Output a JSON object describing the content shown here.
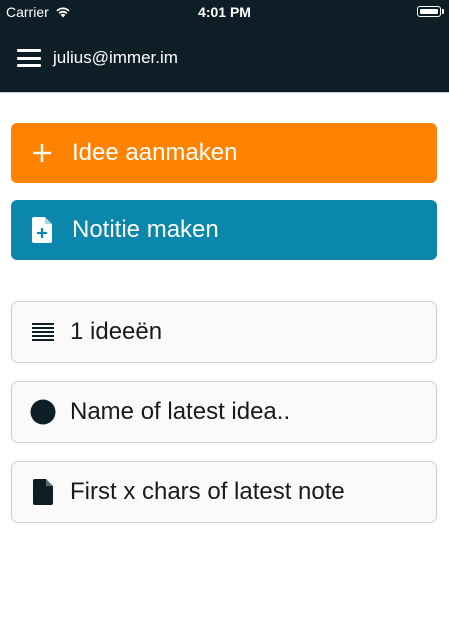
{
  "status_bar": {
    "carrier": "Carrier",
    "time": "4:01 PM",
    "wifi_icon": "wifi-icon",
    "battery_icon": "battery-icon"
  },
  "nav": {
    "menu_icon": "hamburger-menu-icon",
    "user_email": "julius@immer.im",
    "background_color": "#0d1e26"
  },
  "actions": {
    "create_idea": {
      "label": "Idee aanmaken",
      "icon": "plus-icon",
      "color": "#ff8300"
    },
    "create_note": {
      "label": "Notitie maken",
      "icon": "file-plus-icon",
      "color": "#0a87aa"
    }
  },
  "summary": {
    "ideas_count": {
      "label": "1 ideeën",
      "icon": "list-icon"
    },
    "latest_idea": {
      "label": "Name of latest idea..",
      "icon": "circle-icon"
    },
    "latest_note": {
      "label": "First x chars of latest note",
      "icon": "file-icon"
    }
  }
}
